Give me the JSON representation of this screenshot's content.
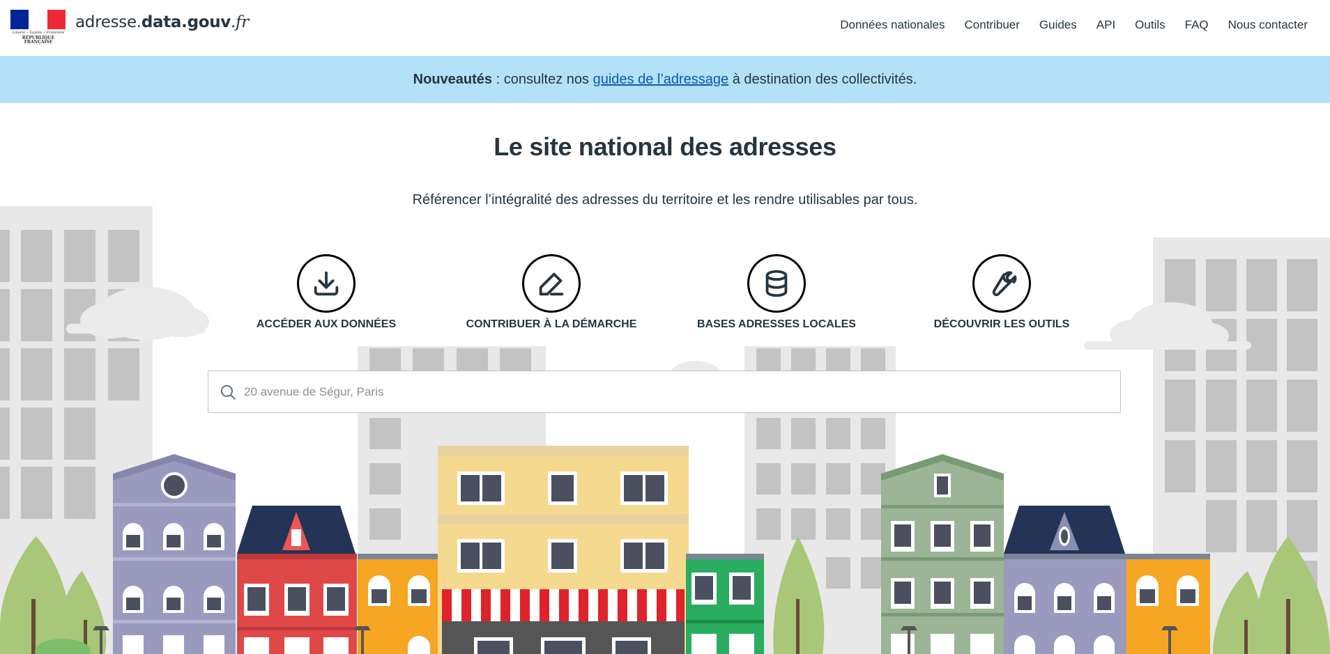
{
  "header": {
    "logo_lines": [
      "Liberté • Égalité • Fraternité",
      "RÉPUBLIQUE FRANÇAISE"
    ],
    "site_name": {
      "part1": "adresse.",
      "part2": "data.gouv",
      "part3": ".fr"
    },
    "nav": [
      "Données nationales",
      "Contribuer",
      "Guides",
      "API",
      "Outils",
      "FAQ",
      "Nous contacter"
    ]
  },
  "banner": {
    "strong": "Nouveautés",
    "text_before": " : consultez nos ",
    "link": "guides de l’adressage",
    "text_after": " à destination des collectivités."
  },
  "hero": {
    "title": "Le site national des adresses",
    "subtitle": "Référencer l’intégralité des adresses du territoire et les rendre utilisables par tous."
  },
  "actions": [
    {
      "label": "ACCÉDER AUX DONNÉES",
      "icon": "download-icon"
    },
    {
      "label": "CONTRIBUER À LA DÉMARCHE",
      "icon": "pencil-icon"
    },
    {
      "label": "BASES ADRESSES LOCALES",
      "icon": "database-icon"
    },
    {
      "label": "DÉCOUVRIR LES OUTILS",
      "icon": "wrench-icon"
    }
  ],
  "search": {
    "placeholder": "20 avenue de Ségur, Paris",
    "value": ""
  },
  "colors": {
    "banner_bg": "#b3e1f7",
    "text": "#26353f",
    "link": "#0a58b6",
    "flag_blue": "#002395",
    "flag_red": "#ed2939"
  }
}
